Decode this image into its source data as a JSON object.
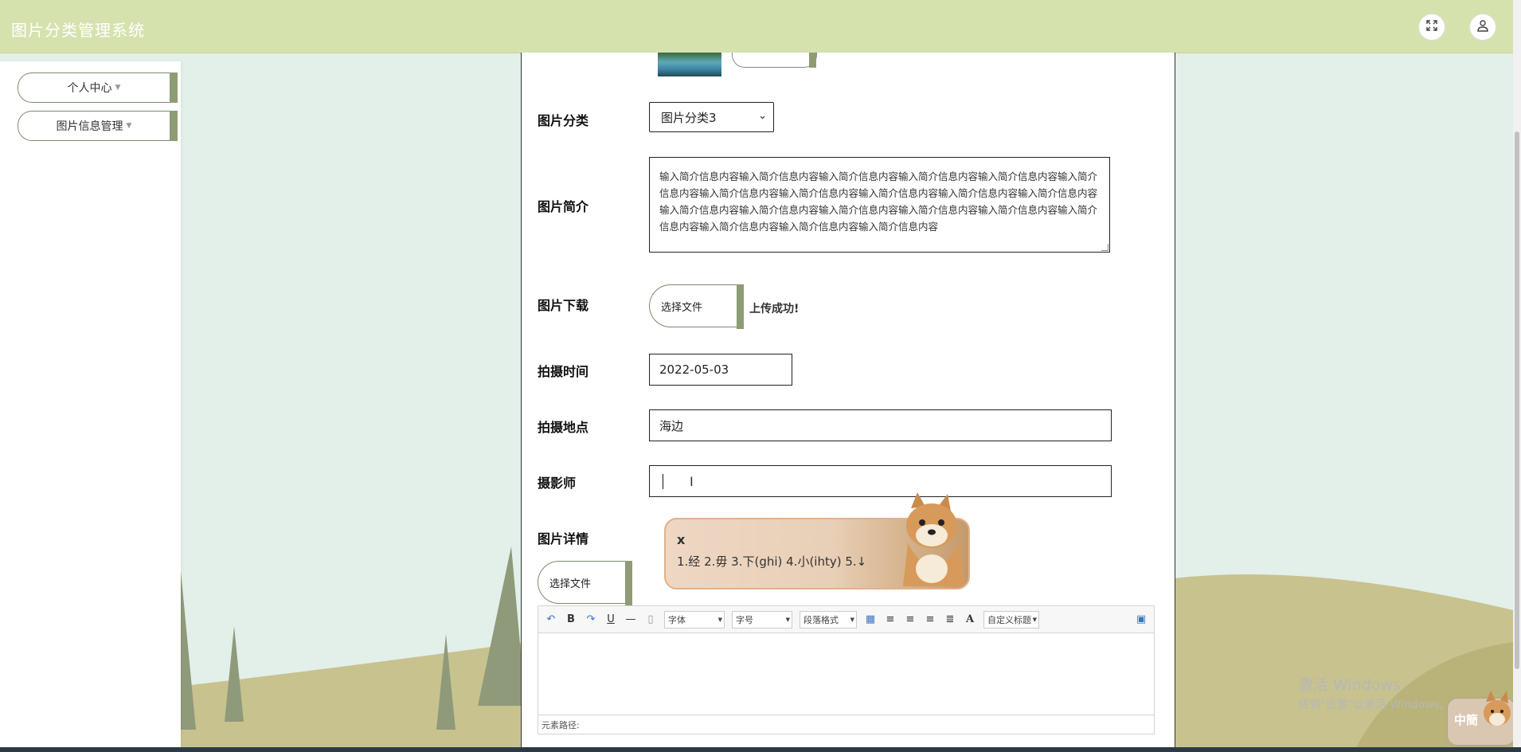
{
  "app": {
    "title": "图片分类管理系统"
  },
  "header": {
    "fullscreen_icon": "expand-icon",
    "user_icon": "user-icon"
  },
  "sidebar": {
    "items": [
      {
        "label": "个人中心"
      },
      {
        "label": "图片信息管理"
      }
    ]
  },
  "form": {
    "category": {
      "label": "图片分类",
      "value": "图片分类3"
    },
    "intro": {
      "label": "图片简介",
      "value": "输入简介信息内容输入简介信息内容输入简介信息内容输入简介信息内容输入简介信息内容输入简介信息内容输入简介信息内容输入简介信息内容输入简介信息内容输入简介信息内容输入简介信息内容输入简介信息内容输入简介信息内容输入简介信息内容输入简介信息内容输入简介信息内容输入简介信息内容输入简介信息内容输入简介信息内容输入简介信息内容"
    },
    "download": {
      "label": "图片下载",
      "button": "选择文件",
      "status": "上传成功!"
    },
    "shoot_time": {
      "label": "拍摄时间",
      "value": "2022-05-03"
    },
    "location": {
      "label": "拍摄地点",
      "value": "海边"
    },
    "photographer": {
      "label": "摄影师",
      "value": ""
    },
    "detail": {
      "label": "图片详情",
      "button": "选择文件"
    }
  },
  "editor": {
    "font_family": "字体",
    "font_size": "字号",
    "paragraph": "段落格式",
    "custom_title": "自定义标题",
    "path_label": "元素路径:"
  },
  "ime": {
    "typed": "x",
    "candidates": "1.经  2.毋  3.下(ghi)  4.小(ihty)  5.↓"
  },
  "watermark": {
    "line1": "激活 Windows",
    "line2": "转到\"设置\"以激活 Windows。"
  },
  "ime_badge": "中簡"
}
